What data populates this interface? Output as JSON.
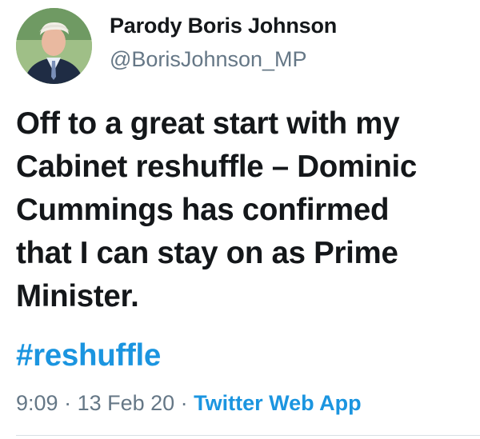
{
  "tweet": {
    "display_name": "Parody Boris Johnson",
    "handle": "@BorisJohnson_MP",
    "text": "Off to a great start with my\nCabinet reshuffle – Dominic\nCummings has confirmed\nthat I can stay on as Prime\nMinister.",
    "hashtag": "#reshuffle",
    "time": "9:09",
    "separator": " · ",
    "date": "13 Feb 20",
    "source": "Twitter Web App"
  },
  "colors": {
    "text": "#14171a",
    "secondary": "#657786",
    "link": "#1b95e0",
    "background": "#ffffff"
  }
}
